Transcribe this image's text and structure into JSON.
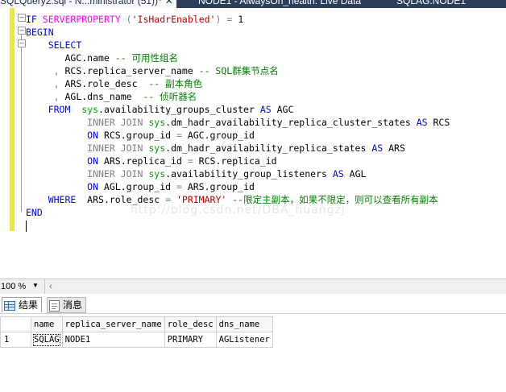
{
  "tabs": [
    {
      "label": "SQLQuery2.sql - N...ministrator (51))*",
      "close": "✕",
      "active": true
    },
    {
      "label": "NODE1 - AlwaysOn_health: Live Data",
      "active": false
    },
    {
      "label": "SQLAG.NODE1",
      "active": false
    }
  ],
  "editor": {
    "watermark": "http://blog.csdn.net/DBA_huangzj"
  },
  "statusbar": {
    "zoom": "100 %",
    "zoom_arrow": "▼",
    "scroll_left": "‹"
  },
  "results_tabs": [
    {
      "label": "结果",
      "icon": "grid-icon",
      "active": true
    },
    {
      "label": "消息",
      "icon": "message-icon",
      "active": false
    }
  ],
  "grid": {
    "columns": [
      "name",
      "replica_server_name",
      "role_desc",
      "dns_name"
    ],
    "rows": [
      {
        "num": "1",
        "cells": [
          "SQLAG",
          "NODE1",
          "PRIMARY",
          "AGListener"
        ]
      }
    ]
  }
}
